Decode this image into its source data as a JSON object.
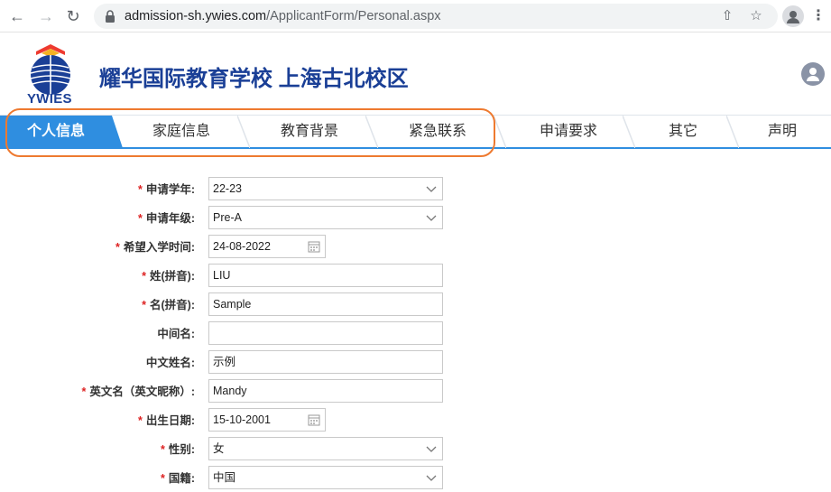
{
  "browser": {
    "url_domain": "admission-sh.ywies.com",
    "url_path": "/ApplicantForm/Personal.aspx"
  },
  "header": {
    "logo_text": "YWIES",
    "title": "耀华国际教育学校 上海古北校区"
  },
  "tabs": [
    {
      "label": "个人信息",
      "active": true
    },
    {
      "label": "家庭信息",
      "active": false
    },
    {
      "label": "教育背景",
      "active": false
    },
    {
      "label": "紧急联系",
      "active": false
    },
    {
      "label": "申请要求",
      "active": false
    },
    {
      "label": "其它",
      "active": false
    },
    {
      "label": "声明",
      "active": false
    }
  ],
  "form": {
    "fields": [
      {
        "label": "申请学年:",
        "required": true,
        "type": "select",
        "value": "22-23"
      },
      {
        "label": "申请年级:",
        "required": true,
        "type": "select",
        "value": "Pre-A"
      },
      {
        "label": "希望入学时间:",
        "required": true,
        "type": "date",
        "value": "24-08-2022"
      },
      {
        "label": "姓(拼音):",
        "required": true,
        "type": "text",
        "value": "LIU"
      },
      {
        "label": "名(拼音):",
        "required": true,
        "type": "text",
        "value": "Sample"
      },
      {
        "label": "中间名:",
        "required": false,
        "type": "text",
        "value": ""
      },
      {
        "label": "中文姓名:",
        "required": false,
        "type": "text",
        "value": "示例"
      },
      {
        "label": "英文名（英文昵称）:",
        "required": true,
        "type": "text",
        "value": "Mandy"
      },
      {
        "label": "出生日期:",
        "required": true,
        "type": "date",
        "value": "15-10-2001"
      },
      {
        "label": "性别:",
        "required": true,
        "type": "select",
        "value": "女"
      },
      {
        "label": "国籍:",
        "required": true,
        "type": "select",
        "value": "中国"
      }
    ]
  },
  "colors": {
    "brand": "#1a3f96",
    "tab_active": "#2f8ee0",
    "highlight": "#ee7a30",
    "required": "#d22"
  }
}
